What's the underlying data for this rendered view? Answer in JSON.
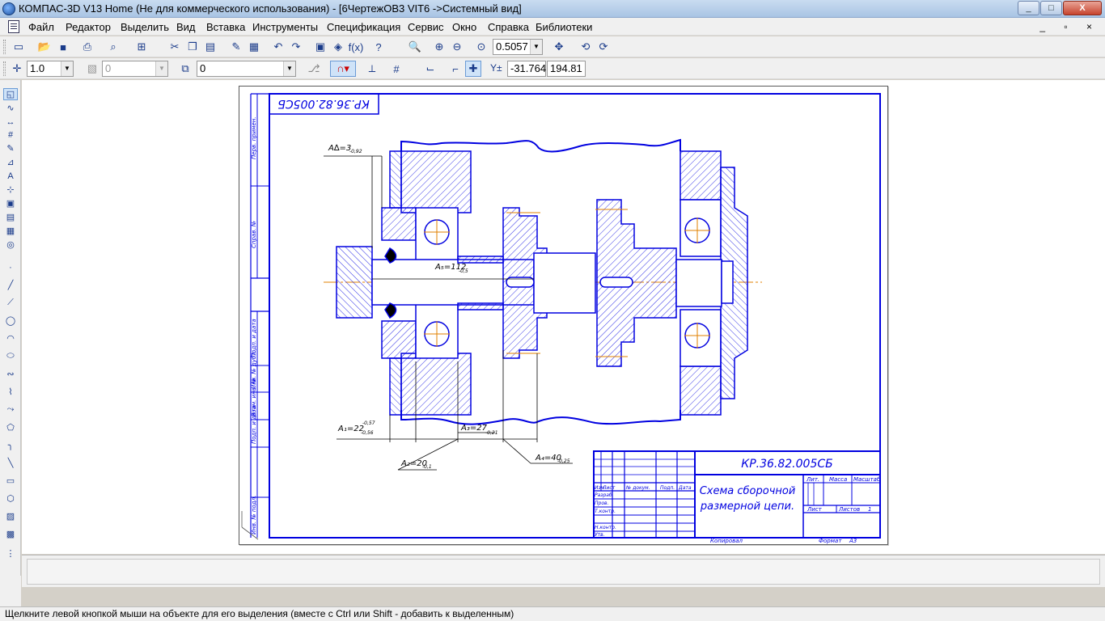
{
  "window": {
    "title": "КОМПАС-3D V13 Home (Не для коммерческого использования) - [6ЧертежОВ3 VIT6 ->Системный вид]",
    "controls": [
      "_",
      "□",
      "X"
    ]
  },
  "menu": {
    "items": [
      "Файл",
      "Редактор",
      "Выделить",
      "Вид",
      "Вставка",
      "Инструменты",
      "Спецификация",
      "Сервис",
      "Окно",
      "Справка",
      "Библиотеки"
    ],
    "mdi_controls": "_ ▫ ×"
  },
  "toolbar1": {
    "zoom_value": "0.5057"
  },
  "toolbar2": {
    "step_value": "1.0",
    "layer_state": "0",
    "layer_value": "0",
    "coord_x": "-31.764",
    "coord_y": "194.81"
  },
  "drawing": {
    "stamp_rotated": "КР.36.82.005СБ",
    "side_columns": [
      "Перв. примен.",
      "Справ. №",
      "Подп. и дата",
      "Инв. № дубл.",
      "Взам. инв. №",
      "Подп. и дата",
      "Инв. № подл."
    ],
    "dimensions": {
      "a_delta": "A∆=3",
      "a_delta_tol": "-0,92",
      "a5": "A₅=112",
      "a5_tol": "-0,5",
      "a1": "A₁=22",
      "a1_tol_up": "-0,57",
      "a1_tol_dn": "-0,56",
      "a3": "A₃=27",
      "a3_tol": "-0,21",
      "a2": "A₂=20",
      "a2_tol": "-0,1",
      "a4": "A₄=40",
      "a4_tol": "-0,25"
    },
    "title_block": {
      "designation": "КР.36.82.005СБ",
      "name_line1": "Схема сборочной",
      "name_line2": "размерной цепи.",
      "col_lit": "Лит.",
      "col_mass": "Масса",
      "col_scale": "Масштаб",
      "sheet": "Лист",
      "sheets": "Листов",
      "sheets_value": "1",
      "rows": [
        "Изм.",
        "Лист",
        "№ докум.",
        "Подп.",
        "Дата"
      ],
      "roles": [
        "Разраб.",
        "Пров.",
        "Т.контр.",
        "Н.контр.",
        "Утв."
      ],
      "copied": "Копировал",
      "format": "Формат",
      "format_value": "А3"
    }
  },
  "status": {
    "text": "Щелкните левой кнопкой мыши на объекте для его выделения (вместе с Ctrl или Shift - добавить к выделенным)"
  },
  "colors": {
    "drawing_line": "#0000e0",
    "axis_line": "#e08000",
    "selection_blue": "#6b9bd6"
  }
}
